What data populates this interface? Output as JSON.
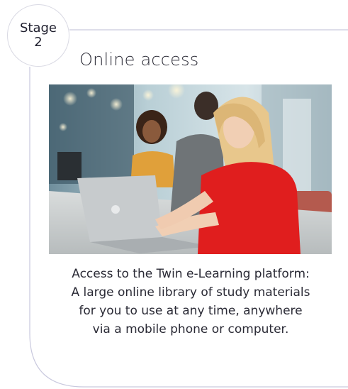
{
  "stage": {
    "label": "Stage",
    "number": "2"
  },
  "section": {
    "title": "Online access"
  },
  "photo": {
    "alt_subject": "student-with-laptop-photo"
  },
  "description": {
    "lines": [
      "Access to the Twin e-Learning platform:",
      "A large online library of study materials",
      "for you to use at any time, anywhere",
      "via a mobile phone or computer."
    ]
  },
  "colors": {
    "frame_line": "#c9c9de",
    "badge_border": "#d9d9e3",
    "text": "#2a2a35",
    "shirt_red": "#e01e1e",
    "hair_blonde": "#e8c78c"
  }
}
